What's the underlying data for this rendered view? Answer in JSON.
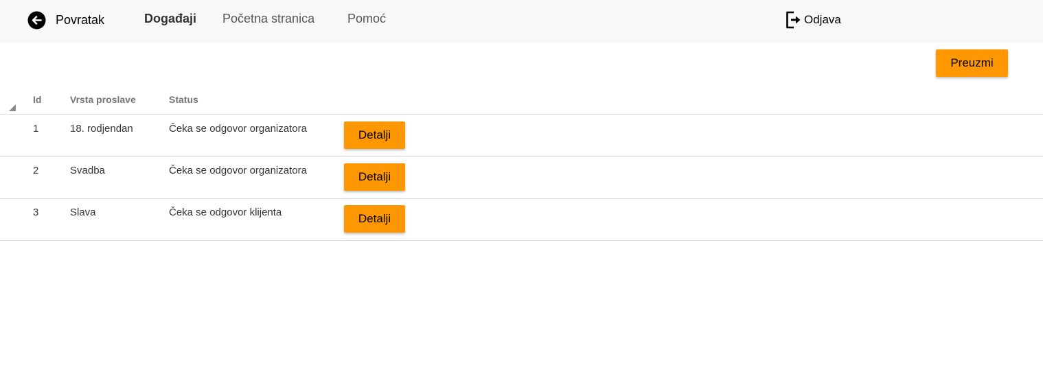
{
  "nav": {
    "back_label": "Povratak",
    "items": [
      {
        "label": "Događaji",
        "active": true
      },
      {
        "label": "Početna stranica",
        "active": false
      },
      {
        "label": "Pomoć",
        "active": false
      }
    ],
    "logout_label": "Odjava"
  },
  "toolbar": {
    "download_label": "Preuzmi"
  },
  "table": {
    "columns": [
      "Id",
      "Vrsta proslave",
      "Status"
    ],
    "rows": [
      {
        "id": "1",
        "type": "18. rodjendan",
        "status": "Čeka se odgovor organizatora",
        "action": "Detalji"
      },
      {
        "id": "2",
        "type": "Svadba",
        "status": "Čeka se odgovor organizatora",
        "action": "Detalji"
      },
      {
        "id": "3",
        "type": "Slava",
        "status": "Čeka se odgovor klijenta",
        "action": "Detalji"
      }
    ]
  },
  "colors": {
    "accent": "#ff9800",
    "topbar_bg": "#f8f8f8",
    "header_text": "#757575"
  }
}
